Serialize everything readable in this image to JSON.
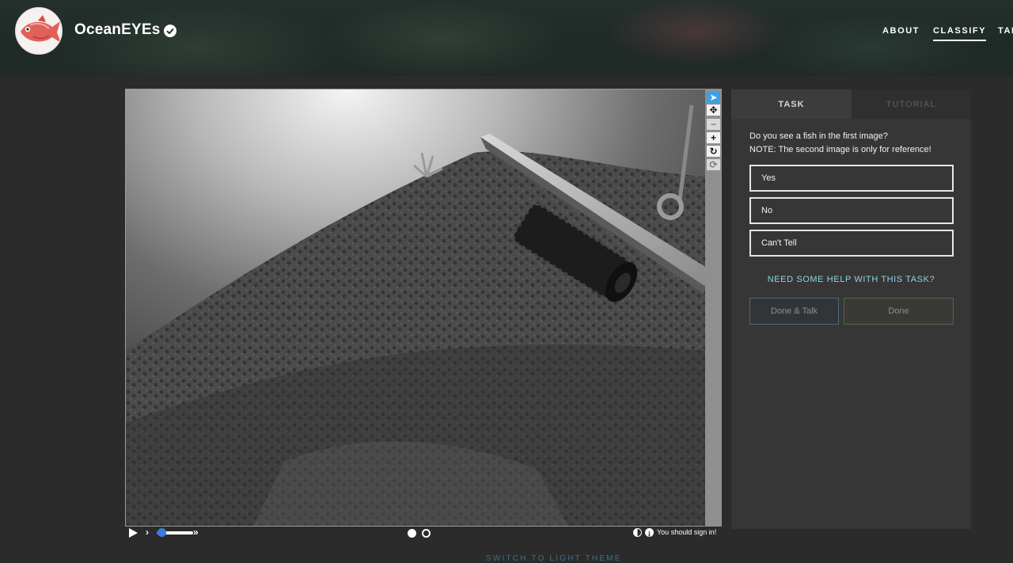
{
  "project": {
    "title": "OceanEYEs",
    "verified_icon": "verified-check-icon",
    "avatar_icon": "red-fish-icon"
  },
  "nav": {
    "items": [
      {
        "label": "ABOUT",
        "active": false
      },
      {
        "label": "CLASSIFY",
        "active": true
      },
      {
        "label": "TAL",
        "active": false
      }
    ]
  },
  "viewer": {
    "tools": [
      {
        "icon": "pointer-icon",
        "glyph": "➤",
        "active": true
      },
      {
        "icon": "move-icon",
        "glyph": "✥",
        "active": false
      },
      {
        "icon": "zoom-out-icon",
        "glyph": "−",
        "active": false
      },
      {
        "icon": "zoom-in-icon",
        "glyph": "+",
        "active": false
      },
      {
        "icon": "rotate-icon",
        "glyph": "↻",
        "active": false
      },
      {
        "icon": "reset-icon",
        "glyph": "⟳",
        "active": false
      }
    ],
    "controls": {
      "play_icon": "play-icon",
      "slow_glyph": "›",
      "fast_glyph": "»",
      "speed_level": 0.2,
      "frames_total": 2,
      "frame_current": 1,
      "signin_text": "You should sign in!"
    }
  },
  "task_panel": {
    "tabs": [
      {
        "label": "TASK",
        "active": true
      },
      {
        "label": "TUTORIAL",
        "active": false
      }
    ],
    "question_line1": "Do you see a fish in the first image?",
    "question_line2": "NOTE: The second image is only for reference!",
    "answers": [
      "Yes",
      "No",
      "Can't Tell"
    ],
    "help_text": "NEED SOME HELP WITH THIS TASK?",
    "done_talk_label": "Done & Talk",
    "done_label": "Done"
  },
  "footer": {
    "theme_switch": "SWITCH TO LIGHT THEME"
  },
  "colors": {
    "page_bg": "#2b2b2b",
    "panel_bg": "#363636",
    "accent_blue": "#3a7be0",
    "help_link": "#8fd2e6",
    "tool_active": "#3aa0e8"
  }
}
